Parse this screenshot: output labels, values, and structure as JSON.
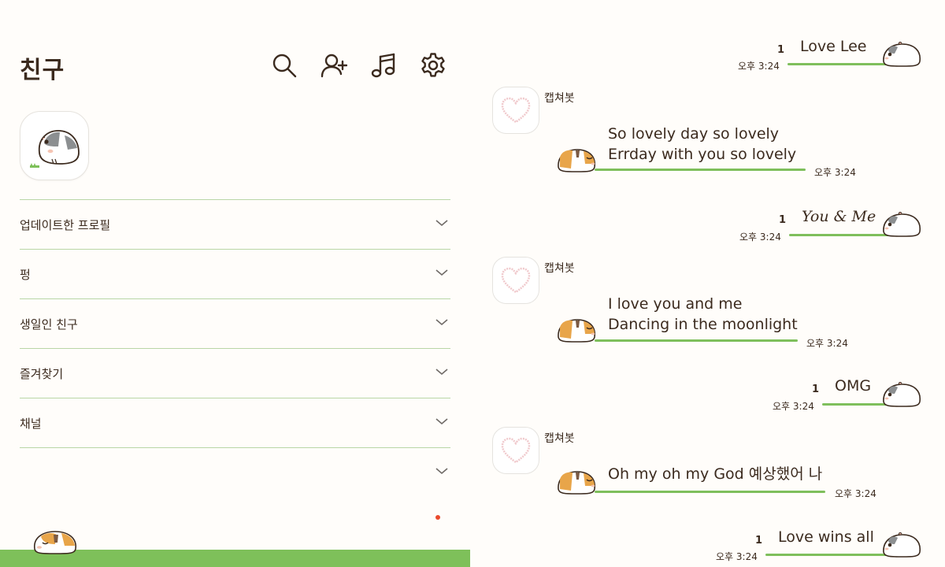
{
  "left": {
    "title": "친구",
    "icons": [
      "search-icon",
      "add-friend-icon",
      "music-icon",
      "settings-icon"
    ],
    "menu": [
      {
        "label": "업데이트한 프로필"
      },
      {
        "label": "펑"
      },
      {
        "label": "생일인 친구"
      },
      {
        "label": "즐겨찾기"
      },
      {
        "label": "채널"
      },
      {
        "label": ""
      }
    ],
    "colors": {
      "ground": "#7ec05a",
      "divider": "#b9d6a6",
      "dot": "#ea4a2c"
    }
  },
  "chat": {
    "messages": [
      {
        "direction": "out",
        "text": "Love Lee",
        "read_count": "1",
        "time": "오후 3:24"
      },
      {
        "direction": "in",
        "sender": "캡쳐봇",
        "lines": [
          "So lovely day so lovely",
          "Errday with you so lovely"
        ],
        "time": "오후 3:24"
      },
      {
        "direction": "out",
        "text": "You & Me",
        "read_count": "1",
        "time": "오후 3:24"
      },
      {
        "direction": "in",
        "sender": "캡쳐봇",
        "lines": [
          "I love you and me",
          "Dancing in the moonlight"
        ],
        "time": "오후 3:24"
      },
      {
        "direction": "out",
        "text": "OMG",
        "read_count": "1",
        "time": "오후 3:24"
      },
      {
        "direction": "in",
        "sender": "캡쳐봇",
        "lines": [
          "Oh my oh my God 예상했어 나"
        ],
        "time": "오후 3:24"
      },
      {
        "direction": "out",
        "text": "Love wins all",
        "read_count": "1",
        "time": "오후 3:24"
      }
    ],
    "colors": {
      "underline": "#7fbf5c"
    }
  }
}
